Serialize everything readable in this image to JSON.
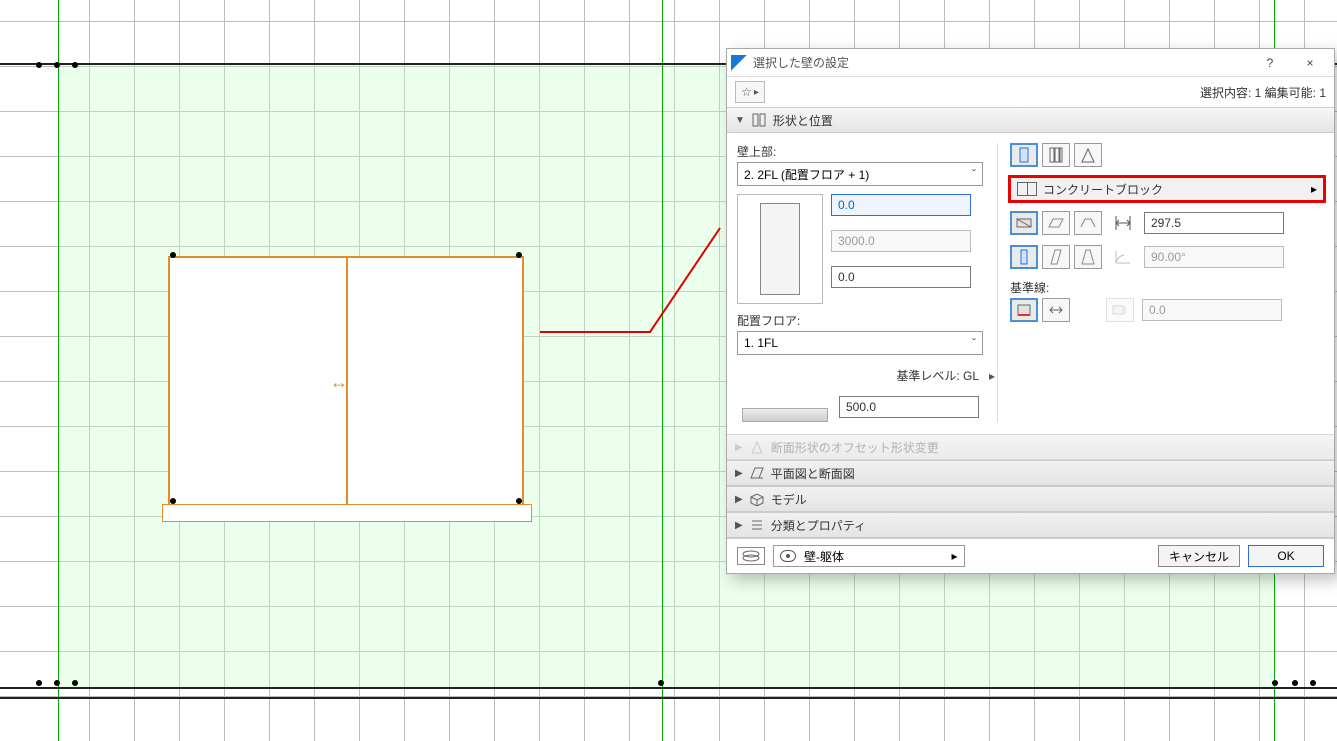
{
  "dialog": {
    "title": "選択した壁の設定",
    "help_tooltip": "?",
    "close_tooltip": "×",
    "selection_info": "選択内容: 1 編集可能: 1",
    "favorite_glyph": "☆",
    "fav_arrow": "▸"
  },
  "sections": {
    "shape_pos": "形状と位置",
    "offset_profile": "断面形状のオフセット形状変更",
    "plan_section": "平面図と断面図",
    "model": "モデル",
    "class_props": "分類とプロパティ"
  },
  "left": {
    "wall_top_label": "壁上部:",
    "wall_top_value": "2. 2FL (配置フロア + 1)",
    "top_offset": "0.0",
    "height": "3000.0",
    "bottom_offset": "0.0",
    "story_label": "配置フロア:",
    "story_value": "1. 1FL",
    "ref_level_label": "基準レベル: GL",
    "ref_level_arrow": "▸",
    "ref_level_value": "500.0"
  },
  "right": {
    "structure_label": "コンクリートブロック",
    "structure_arrow": "▸",
    "thickness": "297.5",
    "angle": "90.00°",
    "baseline_label": "基準線:",
    "baseline_offset": "0.0"
  },
  "footer": {
    "layer_value": "壁-躯体",
    "layer_arrow": "▸",
    "cancel": "キャンセル",
    "ok": "OK"
  }
}
